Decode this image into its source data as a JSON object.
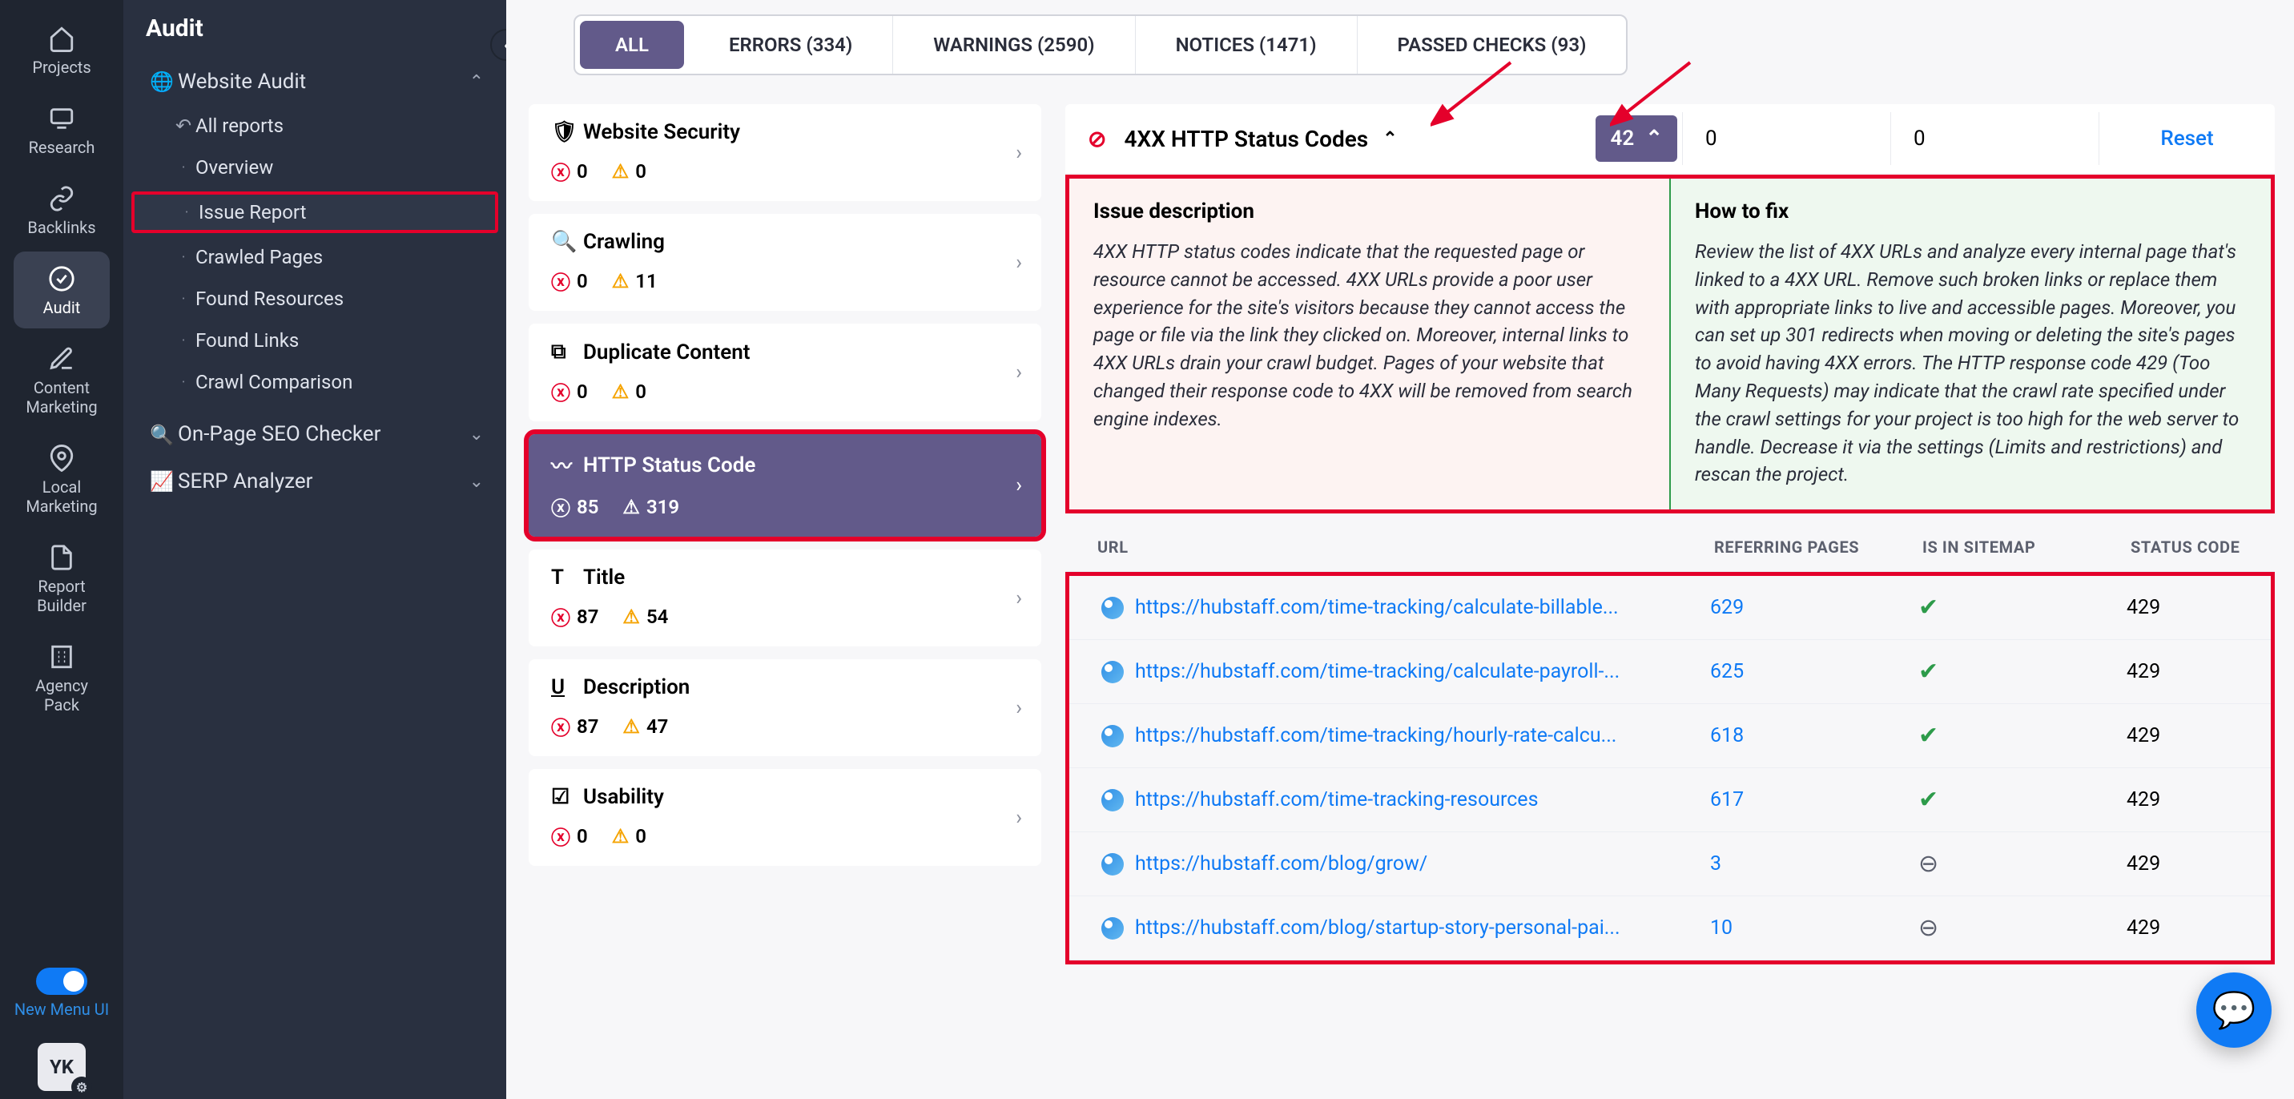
{
  "rail": {
    "items": [
      {
        "label": "Projects"
      },
      {
        "label": "Research"
      },
      {
        "label": "Backlinks"
      },
      {
        "label": "Audit"
      },
      {
        "label": "Content Marketing"
      },
      {
        "label": "Local Marketing"
      },
      {
        "label": "Report Builder"
      },
      {
        "label": "Agency Pack"
      }
    ],
    "toggle_label": "New Menu UI",
    "avatar": "YK"
  },
  "sidebar": {
    "title": "Audit",
    "section_audit": "Website Audit",
    "subs": {
      "all_reports": "All reports",
      "overview": "Overview",
      "issue_report": "Issue Report",
      "crawled_pages": "Crawled Pages",
      "found_resources": "Found Resources",
      "found_links": "Found Links",
      "crawl_comparison": "Crawl Comparison"
    },
    "onpage": "On-Page SEO Checker",
    "serp": "SERP Analyzer"
  },
  "filters": {
    "all": "ALL",
    "errors": "ERRORS (334)",
    "warnings": "WARNINGS (2590)",
    "notices": "NOTICES (1471)",
    "passed": "PASSED CHECKS (93)"
  },
  "categories": [
    {
      "name": "Website Security",
      "err": "0",
      "warn": "0"
    },
    {
      "name": "Crawling",
      "err": "0",
      "warn": "11"
    },
    {
      "name": "Duplicate Content",
      "err": "0",
      "warn": "0"
    },
    {
      "name": "HTTP Status Code",
      "err": "85",
      "warn": "319"
    },
    {
      "name": "Title",
      "err": "87",
      "warn": "54"
    },
    {
      "name": "Description",
      "err": "87",
      "warn": "47"
    },
    {
      "name": "Usability",
      "err": "0",
      "warn": "0"
    }
  ],
  "issue": {
    "name": "4XX HTTP Status Codes",
    "count": "42",
    "zero1": "0",
    "zero2": "0",
    "reset": "Reset"
  },
  "info": {
    "desc_title": "Issue description",
    "desc_text": "4XX HTTP status codes indicate that the requested page or resource cannot be accessed. 4XX URLs provide a poor user experience for the site's visitors because they cannot access the page or file via the link they clicked on. Moreover, internal links to 4XX URLs drain your crawl budget. Pages of your website that changed their response code to 4XX will be removed from search engine indexes.",
    "fix_title": "How to fix",
    "fix_text": "Review the list of 4XX URLs and analyze every internal page that's linked to a 4XX URL. Remove such broken links or replace them with appropriate links to live and accessible pages. Moreover, you can set up 301 redirects when moving or deleting the site's pages to avoid having 4XX errors. The HTTP response code 429 (Too Many Requests) may indicate that the crawl rate specified under the crawl settings for your project is too high for the web server to handle. Decrease it via the settings (Limits and restrictions) and rescan the project."
  },
  "table": {
    "head": {
      "url": "URL",
      "ref": "REFERRING PAGES",
      "site": "IS IN SITEMAP",
      "stat": "STATUS CODE"
    },
    "rows": [
      {
        "url": "https://hubstaff.com/time-tracking/calculate-billable...",
        "ref": "629",
        "site": "yes",
        "stat": "429"
      },
      {
        "url": "https://hubstaff.com/time-tracking/calculate-payroll-...",
        "ref": "625",
        "site": "yes",
        "stat": "429"
      },
      {
        "url": "https://hubstaff.com/time-tracking/hourly-rate-calcu...",
        "ref": "618",
        "site": "yes",
        "stat": "429"
      },
      {
        "url": "https://hubstaff.com/time-tracking-resources",
        "ref": "617",
        "site": "yes",
        "stat": "429"
      },
      {
        "url": "https://hubstaff.com/blog/grow/",
        "ref": "3",
        "site": "no",
        "stat": "429"
      },
      {
        "url": "https://hubstaff.com/blog/startup-story-personal-pai...",
        "ref": "10",
        "site": "no",
        "stat": "429"
      }
    ]
  }
}
